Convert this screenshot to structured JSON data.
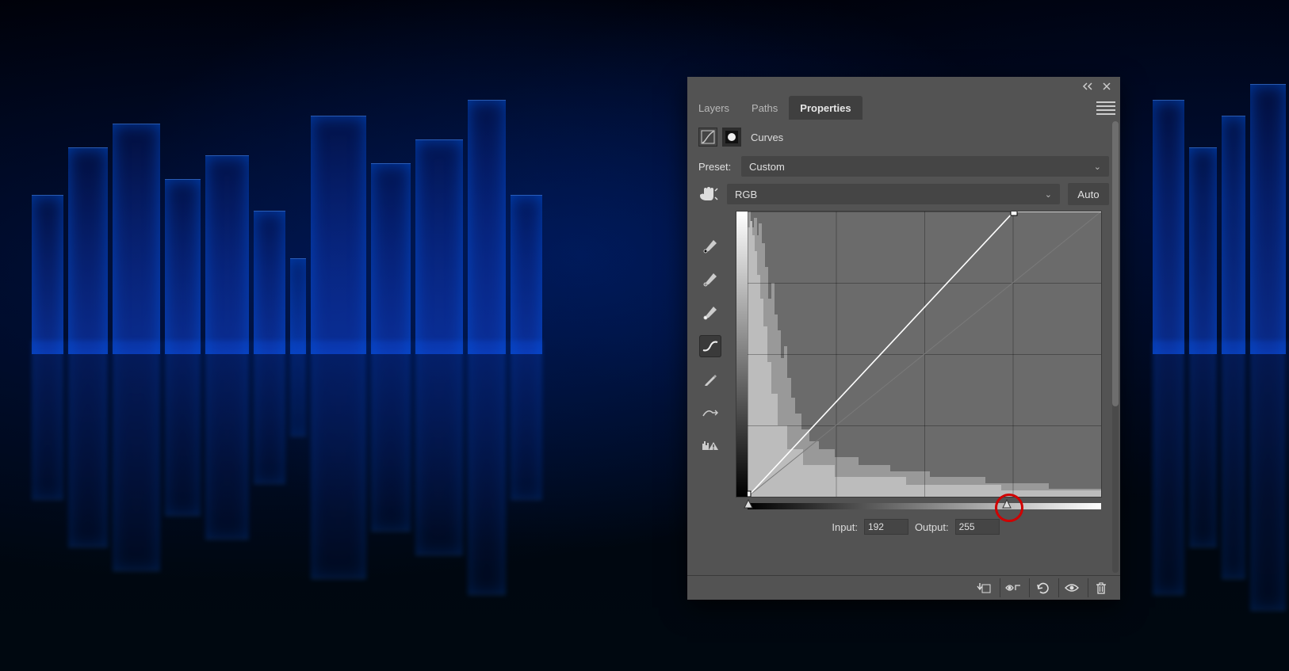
{
  "tabs": {
    "layers": "Layers",
    "paths": "Paths",
    "properties": "Properties"
  },
  "adjustment": {
    "label": "Curves"
  },
  "preset": {
    "label": "Preset:",
    "value": "Custom"
  },
  "channel": {
    "value": "RGB",
    "auto_label": "Auto"
  },
  "io": {
    "input_label": "Input:",
    "input_value": "192",
    "output_label": "Output:",
    "output_value": "255"
  },
  "icons": {
    "collapse": "collapse-icon",
    "close": "close-icon",
    "menu": "flyout-menu-icon",
    "finger": "on-image-adjust-icon",
    "dropper_black": "black-point-dropper-icon",
    "dropper_gray": "gray-point-dropper-icon",
    "dropper_white": "white-point-dropper-icon",
    "curve_edit": "curve-point-tool-icon",
    "pencil": "draw-curve-pencil-icon",
    "smooth": "smooth-curve-icon",
    "clip_warn": "clipping-warning-icon",
    "curves_adj": "curves-adjustment-icon",
    "mask": "layer-mask-icon",
    "clip_to": "clip-to-layer-icon",
    "view_prev": "view-previous-icon",
    "reset": "reset-icon",
    "visibility": "visibility-icon",
    "trash": "trash-icon"
  },
  "curve_points": {
    "highlight": {
      "input": 192,
      "output": 255
    }
  },
  "chart_data": {
    "type": "line",
    "title": "Curves",
    "xlabel": "Input",
    "ylabel": "Output",
    "xlim": [
      0,
      255
    ],
    "ylim": [
      0,
      255
    ],
    "series": [
      {
        "name": "RGB tone curve",
        "points": [
          {
            "input": 0,
            "output": 0
          },
          {
            "input": 192,
            "output": 255
          }
        ]
      },
      {
        "name": "Identity baseline",
        "points": [
          {
            "input": 0,
            "output": 0
          },
          {
            "input": 255,
            "output": 255
          }
        ]
      }
    ],
    "histogram_hint": "Dark-heavy histogram: most pixels near 0–30, falling off toward highlights",
    "slider_black": 0,
    "slider_white": 192
  }
}
